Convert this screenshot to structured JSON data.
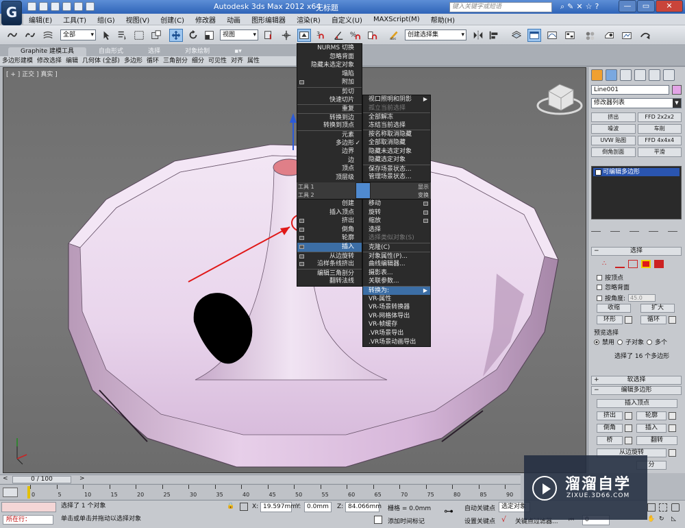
{
  "app": {
    "logo": "G",
    "title": "Autodesk 3ds Max  2012 x64",
    "file": "无标题",
    "search_placeholder": "键入关键字或短语",
    "window_controls": [
      "—",
      "▭",
      "✕"
    ]
  },
  "menu": [
    "编辑(E)",
    "工具(T)",
    "组(G)",
    "视图(V)",
    "创建(C)",
    "修改器",
    "动画",
    "图形编辑器",
    "渲染(R)",
    "自定义(U)",
    "MAXScript(M)",
    "帮助(H)"
  ],
  "toolbar": {
    "selection_filter": "全部",
    "ref_coord": "视图",
    "named_selection": "创建选择集",
    "snap_labels": [
      "3",
      "2.5",
      "%",
      "n"
    ]
  },
  "ribbon": {
    "tabs": [
      "Graphite 建模工具",
      "自由形式",
      "选择",
      "对象绘制",
      "▪▾"
    ],
    "sub": [
      "多边形建模",
      "修改选择",
      "编辑",
      "几何体 (全部)",
      "多边形",
      "循环",
      "三角剖分",
      "细分",
      "可见性",
      "对齐",
      "属性"
    ]
  },
  "viewport": {
    "label": "[ + ] 正交 ] 真实 ]"
  },
  "quad_left_top": [
    {
      "label": "NURMS 切换"
    },
    {
      "label": "忽略背面"
    },
    {
      "label": "隐藏未选定对象"
    },
    {
      "label": "塌陷"
    },
    {
      "label": "附加",
      "box": true
    },
    {
      "label": "剪切",
      "sep": true
    },
    {
      "label": "快速切片"
    },
    {
      "label": "重复",
      "sep": true
    },
    {
      "label": "转换到边",
      "sep": true
    },
    {
      "label": "转换到顶点"
    },
    {
      "label": "元素",
      "sep": true
    },
    {
      "label": "多边形",
      "check": true
    },
    {
      "label": "边界"
    },
    {
      "label": "边"
    },
    {
      "label": "顶点"
    },
    {
      "label": "顶层级"
    }
  ],
  "quad_right_top": [
    {
      "label": "视口照明和阴影",
      "arrow": true
    },
    {
      "label": "孤立当前选择",
      "dis": true
    },
    {
      "label": "全部解冻",
      "sep": true
    },
    {
      "label": "冻结当前选择"
    },
    {
      "label": "按名称取消隐藏",
      "sep": true
    },
    {
      "label": "全部取消隐藏"
    },
    {
      "label": "隐藏未选定对象"
    },
    {
      "label": "隐藏选定对象"
    },
    {
      "label": "保存场景状态...",
      "sep": true
    },
    {
      "label": "管理场景状态..."
    }
  ],
  "quad_headers": {
    "tools1": "工具 1",
    "tools2": "工具 2",
    "display": "显示",
    "transform": "变换"
  },
  "quad_left_bottom": [
    {
      "label": "创建"
    },
    {
      "label": "插入顶点"
    },
    {
      "label": "挤出",
      "box": true
    },
    {
      "label": "倒角",
      "box": true
    },
    {
      "label": "轮廓",
      "box": true
    },
    {
      "label": "插入",
      "box": true,
      "hi": true
    },
    {
      "label": "从边旋转",
      "box": true,
      "sep": true
    },
    {
      "label": "沿样条线挤出",
      "box": true
    },
    {
      "label": "编辑三角剖分",
      "sep": true
    },
    {
      "label": "翻转法线"
    }
  ],
  "quad_right_bottom": [
    {
      "label": "移动",
      "rbox": true
    },
    {
      "label": "旋转",
      "rbox": true
    },
    {
      "label": "缩放",
      "rbox": true
    },
    {
      "label": "选择"
    },
    {
      "label": "选择类似对象(S)",
      "dis": true
    },
    {
      "label": "克隆(C)",
      "sep": true
    },
    {
      "label": "对象属性(P)...",
      "sep": true
    },
    {
      "label": "曲线编辑器..."
    },
    {
      "label": "摄影表..."
    },
    {
      "label": "关联参数..."
    },
    {
      "label": "转换为:",
      "arrow": true,
      "hi": true,
      "sep": true
    },
    {
      "label": "VR-属性"
    },
    {
      "label": "VR-场景转换器"
    },
    {
      "label": "VR-网格体导出"
    },
    {
      "label": "VR-帧缓存"
    },
    {
      "label": ".VR场景导出"
    },
    {
      "label": ".VR场景动画导出"
    }
  ],
  "cmd": {
    "object_name": "Line001",
    "object_color": "#e3a4e6",
    "modifier_list": "修改器列表",
    "mod_buttons": [
      "挤出",
      "FFD 2x2x2",
      "噪波",
      "车削",
      "UVW 贴图",
      "FFD 4x4x4",
      "倒角剖面",
      "平滑"
    ],
    "stack_item": "可编辑多边形",
    "selection_title": "选择",
    "by_vertex": "按顶点",
    "ignore_backface": "忽略背面",
    "by_angle": "按角度:",
    "angle_value": "45.0",
    "shrink": "收缩",
    "grow": "扩大",
    "ring": "环形",
    "loop": "循环",
    "preview_title": "预览选择",
    "preview_off": "禁用",
    "preview_sub": "子对象",
    "preview_multi": "多个",
    "selected_info": "选择了 16 个多边形",
    "soft_sel": "软选择",
    "edit_poly": "编辑多边形",
    "insert_vertex": "插入顶点",
    "extrude": "挤出",
    "outline": "轮廓",
    "bevel": "倒角",
    "inset": "插入",
    "bridge": "桥",
    "flip": "翻转",
    "hinge": "从边旋转",
    "extra_tail": [
      "分",
      "旋转"
    ]
  },
  "timeline": {
    "frame": "0 / 100",
    "ticks": [
      "0",
      "5",
      "10",
      "15",
      "20",
      "25",
      "30",
      "35",
      "40",
      "45",
      "50",
      "55",
      "60",
      "65",
      "70",
      "75",
      "80",
      "85",
      "90"
    ]
  },
  "status": {
    "mini_listener": "所在行：",
    "selected": "选择了 1 个对象",
    "prompt": "单击或单击并拖动以选择对象",
    "x_label": "X:",
    "x_value": "19.597mm",
    "y_label": "Y:",
    "y_value": "0.0mm",
    "z_label": "Z:",
    "z_value": "84.066mm",
    "grid": "栅格 = 0.0mm",
    "add_time_tag": "添加时间标记",
    "auto_key": "自动关键点",
    "auto_key_mode": "选定对象",
    "set_key": "设置关键点",
    "key_filters": "关键点过滤器...",
    "frame_field": "0"
  },
  "watermark": {
    "cn": "溜溜自学",
    "url": "ZIXUE.3D66.COM"
  }
}
